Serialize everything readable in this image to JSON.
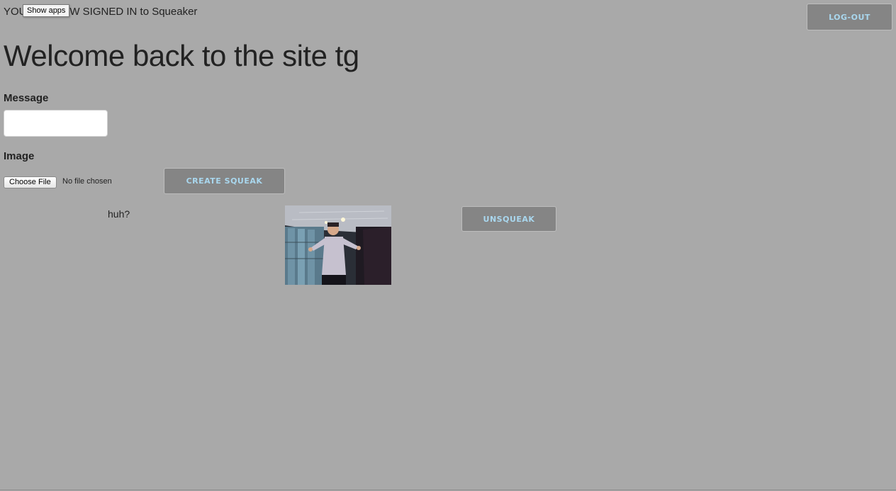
{
  "header": {
    "signed_in_text": "YOU ARE NOW SIGNED IN to Squeaker",
    "show_apps_tooltip": "Show apps",
    "logout_label": "LOG-OUT"
  },
  "welcome": {
    "heading": "Welcome back to the site tg"
  },
  "form": {
    "message_label": "Message",
    "message_value": "",
    "image_label": "Image",
    "choose_file_label": "Choose File",
    "no_file_text": "No file chosen",
    "create_label": "CREATE SQUEAK"
  },
  "squeaks": [
    {
      "message": "huh?",
      "image_icon": "photo-of-person-shrugging",
      "unsqueak_label": "UNSQUEAK"
    }
  ],
  "colors": {
    "page_background": "#a9a9a9",
    "button_background": "#858585",
    "button_text": "#a9d7ee"
  }
}
